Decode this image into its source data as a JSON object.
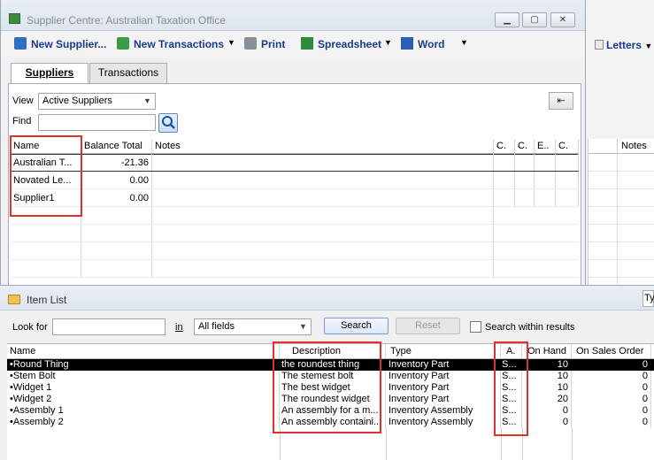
{
  "supplier_centre": {
    "title": "Supplier Centre: Australian Taxation Office",
    "toolbar": {
      "new_supplier": "New Supplier...",
      "new_transactions": "New Transactions",
      "print": "Print",
      "spreadsheet": "Spreadsheet",
      "word": "Word",
      "letters": "Letters"
    },
    "tabs": [
      "Suppliers",
      "Transactions"
    ],
    "view_label": "View",
    "view_value": "Active Suppliers",
    "find_label": "Find",
    "find_value": "",
    "columns": [
      "Name",
      "Balance Total",
      "Notes",
      "C.",
      "C.",
      "E..",
      "C."
    ],
    "right_notes_header": "Notes",
    "rows": [
      {
        "name": "Australian T...",
        "balance": "-21.36"
      },
      {
        "name": "Novated Le...",
        "balance": "0.00"
      },
      {
        "name": "Supplier1",
        "balance": "0.00"
      }
    ]
  },
  "item_list": {
    "title": "Item List",
    "ty_label": "Ty",
    "look_for_label": "Look for",
    "look_for_value": "",
    "in_label": "in",
    "in_value": "All fields",
    "search_label": "Search",
    "reset_label": "Reset",
    "search_within_label": "Search within results",
    "columns": [
      "Name",
      "Description",
      "Type",
      "A.",
      "On Hand",
      "On Sales Order"
    ],
    "rows": [
      {
        "name": "•Round Thing",
        "description": "the roundest thing",
        "type": "Inventory Part",
        "a": "S...",
        "on_hand": "10",
        "on_sales_order": "0"
      },
      {
        "name": "•Stem Bolt",
        "description": "The stemest bolt",
        "type": "Inventory Part",
        "a": "S...",
        "on_hand": "10",
        "on_sales_order": "0"
      },
      {
        "name": "•Widget 1",
        "description": "The best widget",
        "type": "Inventory Part",
        "a": "S...",
        "on_hand": "10",
        "on_sales_order": "0"
      },
      {
        "name": "•Widget 2",
        "description": "The roundest widget",
        "type": "Inventory Part",
        "a": "S...",
        "on_hand": "20",
        "on_sales_order": "0"
      },
      {
        "name": "•Assembly 1",
        "description": "An assembly for a m...",
        "type": "Inventory Assembly",
        "a": "S...",
        "on_hand": "0",
        "on_sales_order": "0"
      },
      {
        "name": "•Assembly 2",
        "description": "An assembly containi...",
        "type": "Inventory Assembly",
        "a": "S...",
        "on_hand": "0",
        "on_sales_order": "0"
      }
    ]
  },
  "colors": {
    "link_blue": "#1b3c8a",
    "highlight_red": "#e03030",
    "selected_row": "#000000"
  }
}
